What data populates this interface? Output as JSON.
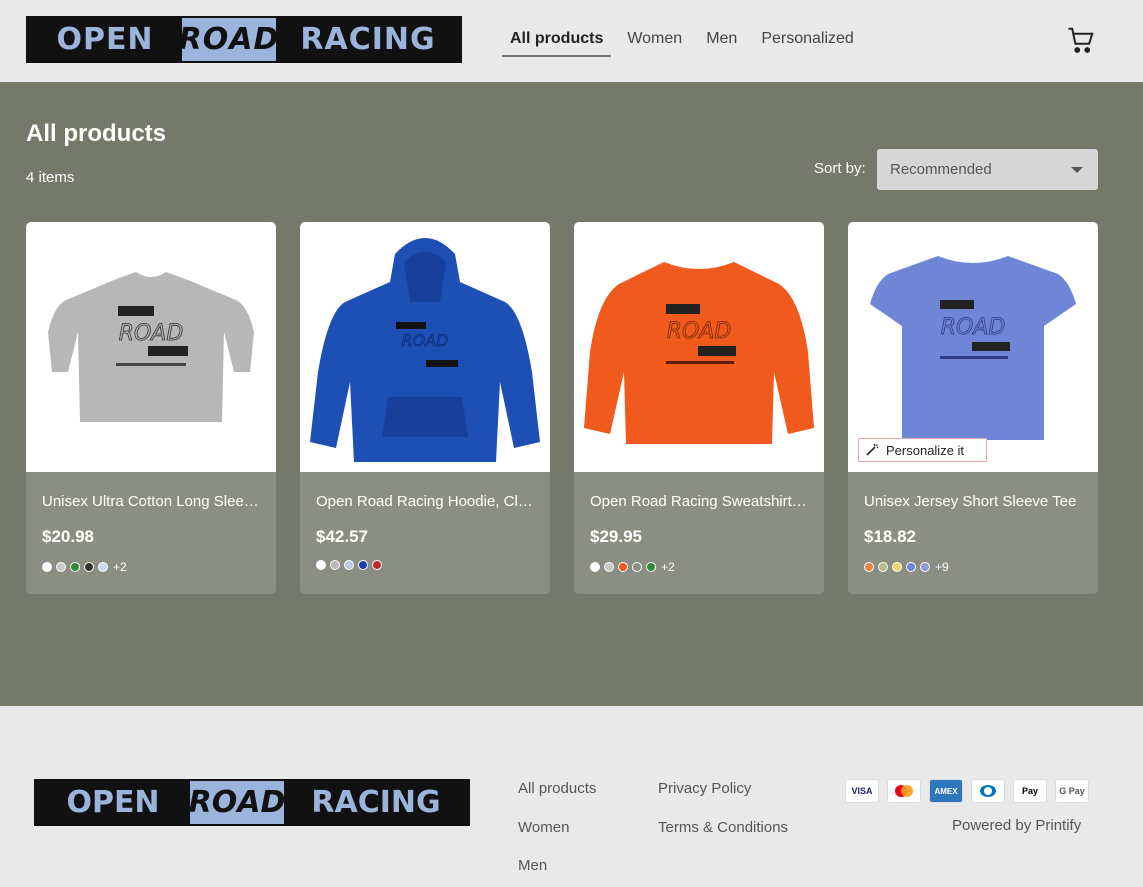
{
  "brand": {
    "logo_part1": "OPEN",
    "logo_part2": "ROAD",
    "logo_part3": "RACING"
  },
  "nav": {
    "items": [
      {
        "label": "All products",
        "active": true
      },
      {
        "label": "Women",
        "active": false
      },
      {
        "label": "Men",
        "active": false
      },
      {
        "label": "Personalized",
        "active": false
      }
    ],
    "cart_icon": "shopping-cart-icon"
  },
  "main": {
    "title": "All products",
    "item_count": "4 items",
    "sort_label": "Sort by:",
    "sort_value": "Recommended"
  },
  "products": [
    {
      "name": "Unisex Ultra Cotton Long Sleeve Tee",
      "price": "$20.98",
      "garment": "long-sleeve-tee",
      "garment_color": "#b7b7b7",
      "swatches": [
        "#ffffff",
        "#c8c8c8",
        "#2e8b3a",
        "#333333",
        "#c9d9ee"
      ],
      "more": "+2",
      "personalize": ""
    },
    {
      "name": "Open Road Racing Hoodie, Classic",
      "price": "$42.57",
      "garment": "hoodie",
      "garment_color": "#1d4fb5",
      "swatches": [
        "#ffffff",
        "#b9b9b9",
        "#b9c9de",
        "#1d3fb0",
        "#c0282d"
      ],
      "more": "",
      "personalize": ""
    },
    {
      "name": "Open Road Racing Sweatshirt, Classic",
      "price": "$29.95",
      "garment": "sweatshirt",
      "garment_color": "#f05a1c",
      "swatches": [
        "#ffffff",
        "#c8c8c8",
        "#f05a1c",
        "#8b8f83",
        "#2e8b3a"
      ],
      "more": "+2",
      "personalize": ""
    },
    {
      "name": "Unisex Jersey Short Sleeve Tee",
      "price": "$18.82",
      "garment": "tshirt",
      "garment_color": "#6f86d6",
      "swatches": [
        "#e8864c",
        "#b7b98a",
        "#f0d36a",
        "#6f86d6",
        "#8f9fcf"
      ],
      "more": "+9",
      "personalize": "Personalize it"
    }
  ],
  "footer": {
    "links_col1": [
      "All products",
      "Women",
      "Men"
    ],
    "links_col2": [
      "Privacy Policy",
      "Terms & Conditions"
    ],
    "payments": [
      "VISA",
      "Mastercard",
      "AMEX",
      "Diners",
      "Pay",
      "G Pay"
    ],
    "powered_by": "Powered by Printify"
  }
}
